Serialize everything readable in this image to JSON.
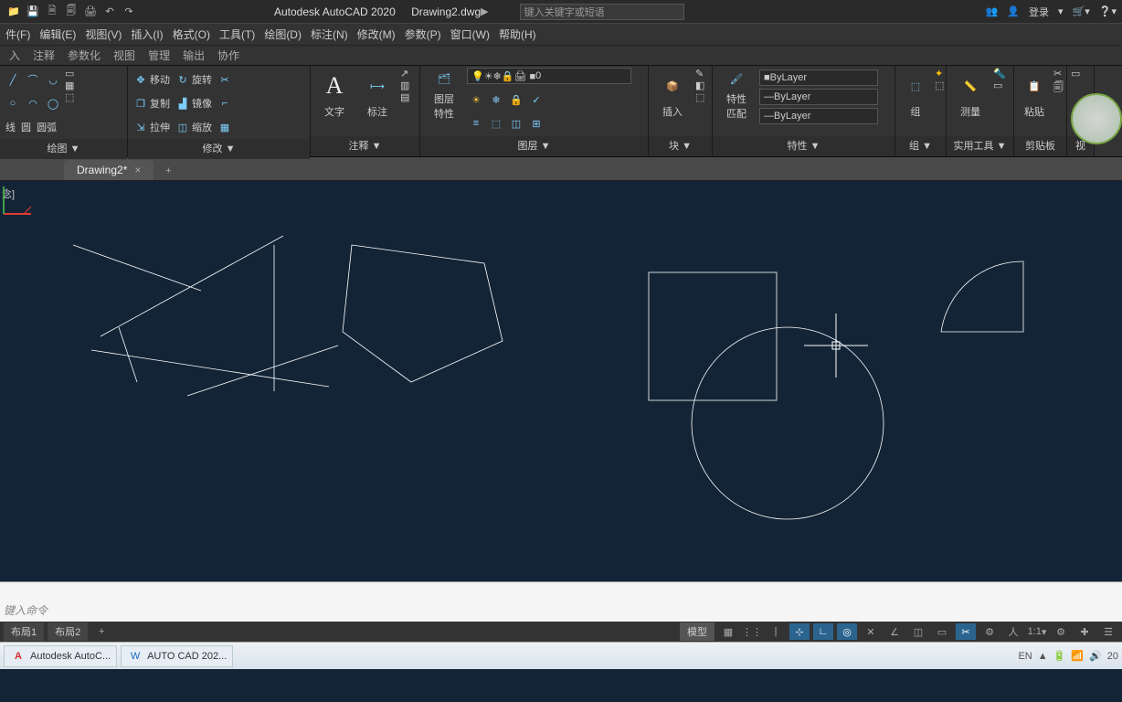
{
  "titlebar": {
    "app_title": "Autodesk AutoCAD 2020",
    "file_name": "Drawing2.dwg",
    "search_placeholder": "键入关键字或短语",
    "login_label": "登录"
  },
  "menubar": {
    "items": [
      "件(F)",
      "编辑(E)",
      "视图(V)",
      "插入(I)",
      "格式(O)",
      "工具(T)",
      "绘图(D)",
      "标注(N)",
      "修改(M)",
      "参数(P)",
      "窗口(W)",
      "帮助(H)"
    ]
  },
  "ribtabs": {
    "items": [
      "入",
      "注释",
      "参数化",
      "视图",
      "管理",
      "输出",
      "协作"
    ]
  },
  "ribbon": {
    "draw": {
      "label": "绘图 ▼",
      "tools": [
        "线",
        "圆",
        "圆弧"
      ]
    },
    "modify": {
      "label": "修改 ▼",
      "tools": {
        "move": "移动",
        "rotate": "旋转",
        "copy": "复制",
        "mirror": "镜像",
        "stretch": "拉伸",
        "scale": "缩放"
      }
    },
    "annot": {
      "label": "注释 ▼",
      "text": "文字",
      "dim": "标注"
    },
    "layer": {
      "label": "图层 ▼",
      "btn": "图层\n特性",
      "cur": "0"
    },
    "block": {
      "label": "块 ▼",
      "btn": "插入"
    },
    "props": {
      "label": "特性 ▼",
      "btn": "特性\n匹配",
      "v1": "ByLayer",
      "v2": "ByLayer",
      "v3": "ByLayer"
    },
    "group": {
      "label": "组 ▼",
      "btn": "组"
    },
    "util": {
      "label": "实用工具 ▼",
      "btn": "测量"
    },
    "clip": {
      "label": "剪贴板",
      "btn": "粘贴"
    },
    "view": {
      "label": "视"
    }
  },
  "filetabs": {
    "tab1": "Drawing2*"
  },
  "drawing": {
    "hint": "念]"
  },
  "cmdline": {
    "prompt": "键入命令"
  },
  "layoutbar": {
    "tab1": "布局1",
    "tab2": "布局2",
    "model": "模型",
    "scale": "1:1"
  },
  "taskbar": {
    "app1": "Autodesk AutoC...",
    "app2": "AUTO  CAD 202...",
    "lang": "EN",
    "time": "20"
  }
}
